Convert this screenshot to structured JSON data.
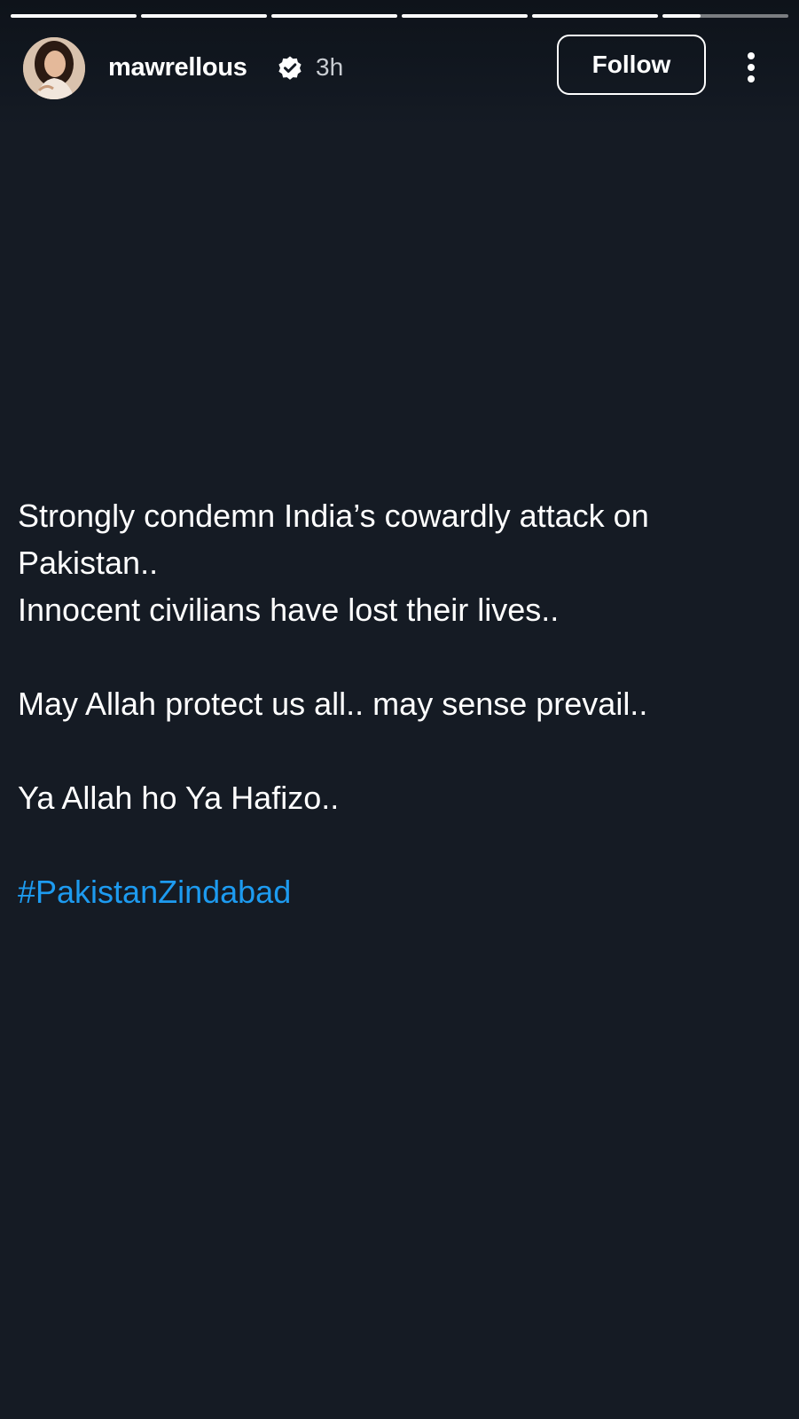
{
  "story": {
    "progress": [
      1,
      1,
      1,
      1,
      1,
      0.3
    ]
  },
  "header": {
    "username": "mawrellous",
    "verified": true,
    "time": "3h",
    "follow_label": "Follow",
    "more_icon": "more-vertical-icon",
    "verified_icon": "verified-badge-icon"
  },
  "post": {
    "line1": "Strongly condemn India’s cowardly attack on Pakistan..",
    "line2": "Innocent civilians have lost their lives..",
    "line3": "May Allah protect us all.. may sense prevail..",
    "line4": "Ya Allah ho Ya Hafizo..",
    "hashtag": "#PakistanZindabad"
  },
  "colors": {
    "background": "#151b24",
    "text": "#ffffff",
    "hashtag": "#1d9bf0",
    "muted": "#c9cdd2"
  }
}
